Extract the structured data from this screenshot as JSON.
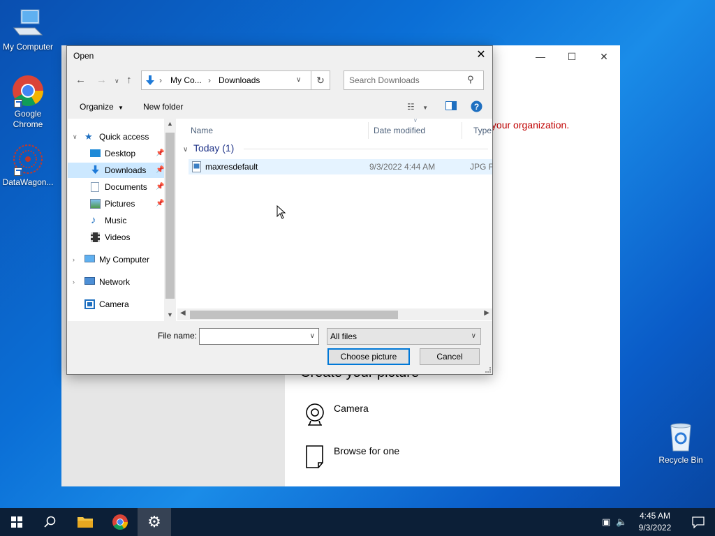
{
  "desktop": {
    "icons": [
      {
        "label": "My Computer"
      },
      {
        "label": "Google Chrome"
      },
      {
        "label": "DataWagon..."
      },
      {
        "label": "Recycle Bin"
      }
    ]
  },
  "settings_window": {
    "managed_text": "ged by your organization.",
    "create_title": "Create your picture",
    "options": [
      {
        "label": "Camera",
        "icon": "camera-icon"
      },
      {
        "label": "Browse for one",
        "icon": "file-icon"
      }
    ]
  },
  "dialog": {
    "title": "Open",
    "breadcrumb": [
      {
        "label": "My Co..."
      },
      {
        "label": "Downloads"
      }
    ],
    "search_placeholder": "Search Downloads",
    "toolbar": {
      "organize": "Organize",
      "new_folder": "New folder"
    },
    "nav": [
      {
        "label": "Quick access"
      },
      {
        "label": "Desktop"
      },
      {
        "label": "Downloads"
      },
      {
        "label": "Documents"
      },
      {
        "label": "Pictures"
      },
      {
        "label": "Music"
      },
      {
        "label": "Videos"
      },
      {
        "label": "My Computer"
      },
      {
        "label": "Network"
      },
      {
        "label": "Camera"
      }
    ],
    "columns": {
      "name": "Name",
      "date": "Date modified",
      "type": "Type"
    },
    "group": "Today (1)",
    "files": [
      {
        "name": "maxresdefault",
        "date": "9/3/2022 4:44 AM",
        "type": "JPG F"
      }
    ],
    "file_name_label": "File name:",
    "file_name_value": "",
    "filter": "All files",
    "choose_button": "Choose picture",
    "cancel_button": "Cancel"
  },
  "taskbar": {
    "time": "4:45 AM",
    "date": "9/3/2022"
  }
}
